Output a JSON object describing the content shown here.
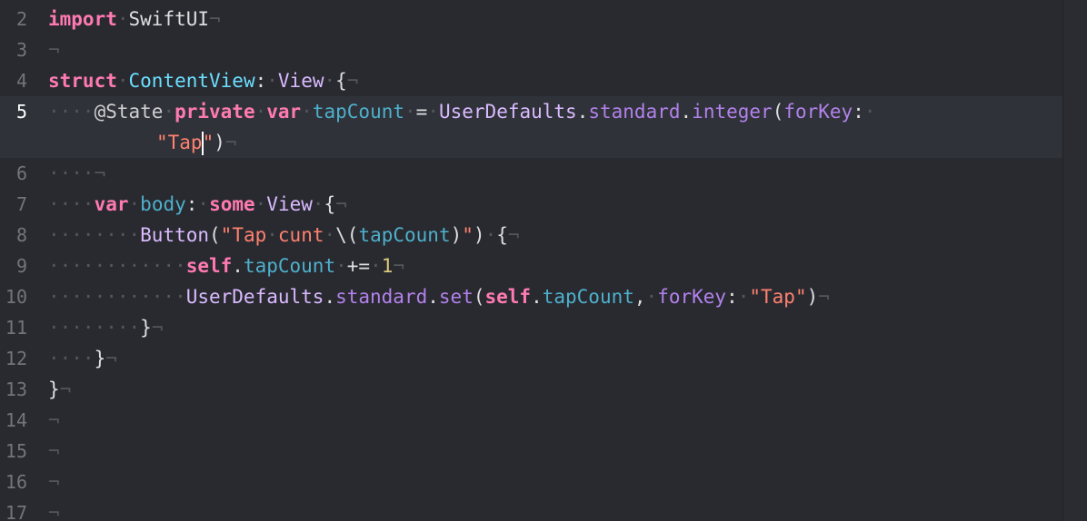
{
  "editor": {
    "current_line": "5",
    "lines": [
      {
        "num": "2",
        "tokens": [
          [
            "kw",
            "import"
          ],
          [
            "ws",
            "·"
          ],
          [
            "plain",
            "SwiftUI"
          ],
          [
            "ws",
            "¬"
          ]
        ]
      },
      {
        "num": "3",
        "tokens": [
          [
            "ws",
            "¬"
          ]
        ]
      },
      {
        "num": "4",
        "tokens": [
          [
            "kw",
            "struct"
          ],
          [
            "ws",
            "·"
          ],
          [
            "dtype",
            "ContentView"
          ],
          [
            "plain",
            ":"
          ],
          [
            "ws",
            "·"
          ],
          [
            "type",
            "View"
          ],
          [
            "ws",
            "·"
          ],
          [
            "plain",
            "{"
          ],
          [
            "ws",
            "¬"
          ]
        ]
      },
      {
        "num": "5",
        "tokens": [
          [
            "ws",
            "····"
          ],
          [
            "attr",
            "@State"
          ],
          [
            "ws",
            "·"
          ],
          [
            "kw",
            "private"
          ],
          [
            "ws",
            "·"
          ],
          [
            "kw",
            "var"
          ],
          [
            "ws",
            "·"
          ],
          [
            "var",
            "tapCount"
          ],
          [
            "ws",
            "·"
          ],
          [
            "plain",
            "="
          ],
          [
            "ws",
            "·"
          ],
          [
            "type",
            "UserDefaults"
          ],
          [
            "plain",
            "."
          ],
          [
            "prop",
            "standard"
          ],
          [
            "plain",
            "."
          ],
          [
            "prop",
            "integer"
          ],
          [
            "plain",
            "("
          ],
          [
            "prop",
            "forKey"
          ],
          [
            "plain",
            ":"
          ],
          [
            "ws",
            "·"
          ]
        ],
        "wrap": [
          [
            "str",
            "\"Tap"
          ],
          [
            "caret",
            ""
          ],
          [
            "str",
            "\""
          ],
          [
            "plain",
            ")"
          ],
          [
            "ws",
            "¬"
          ]
        ]
      },
      {
        "num": "6",
        "tokens": [
          [
            "ws",
            "····¬"
          ]
        ]
      },
      {
        "num": "7",
        "tokens": [
          [
            "ws",
            "····"
          ],
          [
            "kw",
            "var"
          ],
          [
            "ws",
            "·"
          ],
          [
            "var",
            "body"
          ],
          [
            "plain",
            ":"
          ],
          [
            "ws",
            "·"
          ],
          [
            "kw",
            "some"
          ],
          [
            "ws",
            "·"
          ],
          [
            "type",
            "View"
          ],
          [
            "ws",
            "·"
          ],
          [
            "plain",
            "{"
          ],
          [
            "ws",
            "¬"
          ]
        ]
      },
      {
        "num": "8",
        "tokens": [
          [
            "ws",
            "········"
          ],
          [
            "type",
            "Button"
          ],
          [
            "plain",
            "("
          ],
          [
            "str",
            "\"Tap"
          ],
          [
            "ws",
            "·"
          ],
          [
            "str",
            "cunt"
          ],
          [
            "ws",
            "·"
          ],
          [
            "plain",
            "\\("
          ],
          [
            "var",
            "tapCount"
          ],
          [
            "plain",
            ")"
          ],
          [
            "str",
            "\""
          ],
          [
            "plain",
            ")"
          ],
          [
            "ws",
            "·"
          ],
          [
            "plain",
            "{"
          ],
          [
            "ws",
            "¬"
          ]
        ]
      },
      {
        "num": "9",
        "tokens": [
          [
            "ws",
            "············"
          ],
          [
            "kw",
            "self"
          ],
          [
            "plain",
            "."
          ],
          [
            "var",
            "tapCount"
          ],
          [
            "ws",
            "·"
          ],
          [
            "plain",
            "+="
          ],
          [
            "ws",
            "·"
          ],
          [
            "num",
            "1"
          ],
          [
            "ws",
            "¬"
          ]
        ]
      },
      {
        "num": "10",
        "tokens": [
          [
            "ws",
            "············"
          ],
          [
            "type",
            "UserDefaults"
          ],
          [
            "plain",
            "."
          ],
          [
            "prop",
            "standard"
          ],
          [
            "plain",
            "."
          ],
          [
            "prop",
            "set"
          ],
          [
            "plain",
            "("
          ],
          [
            "kw",
            "self"
          ],
          [
            "plain",
            "."
          ],
          [
            "var",
            "tapCount"
          ],
          [
            "plain",
            ","
          ],
          [
            "ws",
            "·"
          ],
          [
            "prop",
            "forKey"
          ],
          [
            "plain",
            ":"
          ],
          [
            "ws",
            "·"
          ],
          [
            "str",
            "\"Tap\""
          ],
          [
            "plain",
            ")"
          ],
          [
            "ws",
            "¬"
          ]
        ]
      },
      {
        "num": "11",
        "tokens": [
          [
            "ws",
            "········"
          ],
          [
            "plain",
            "}"
          ],
          [
            "ws",
            "¬"
          ]
        ]
      },
      {
        "num": "12",
        "tokens": [
          [
            "ws",
            "····"
          ],
          [
            "plain",
            "}"
          ],
          [
            "ws",
            "¬"
          ]
        ]
      },
      {
        "num": "13",
        "tokens": [
          [
            "plain",
            "}"
          ],
          [
            "ws",
            "¬"
          ]
        ]
      },
      {
        "num": "14",
        "tokens": [
          [
            "ws",
            "¬"
          ]
        ]
      },
      {
        "num": "15",
        "tokens": [
          [
            "ws",
            "¬"
          ]
        ]
      },
      {
        "num": "16",
        "tokens": [
          [
            "ws",
            "¬"
          ]
        ]
      },
      {
        "num": "17",
        "tokens": [
          [
            "ws",
            "¬"
          ]
        ]
      }
    ]
  },
  "colors": {
    "background": "#292a30",
    "current_line_background": "#2f3239",
    "keyword": "#ff7ab2",
    "type": "#dabaff",
    "declared_type": "#6bdfff",
    "property": "#b281eb",
    "variable": "#4eb0cc",
    "string": "#ff8170",
    "number": "#d9c97c",
    "plain": "#dfdfe0",
    "invisibles": "#55565c",
    "line_number": "#747478"
  }
}
